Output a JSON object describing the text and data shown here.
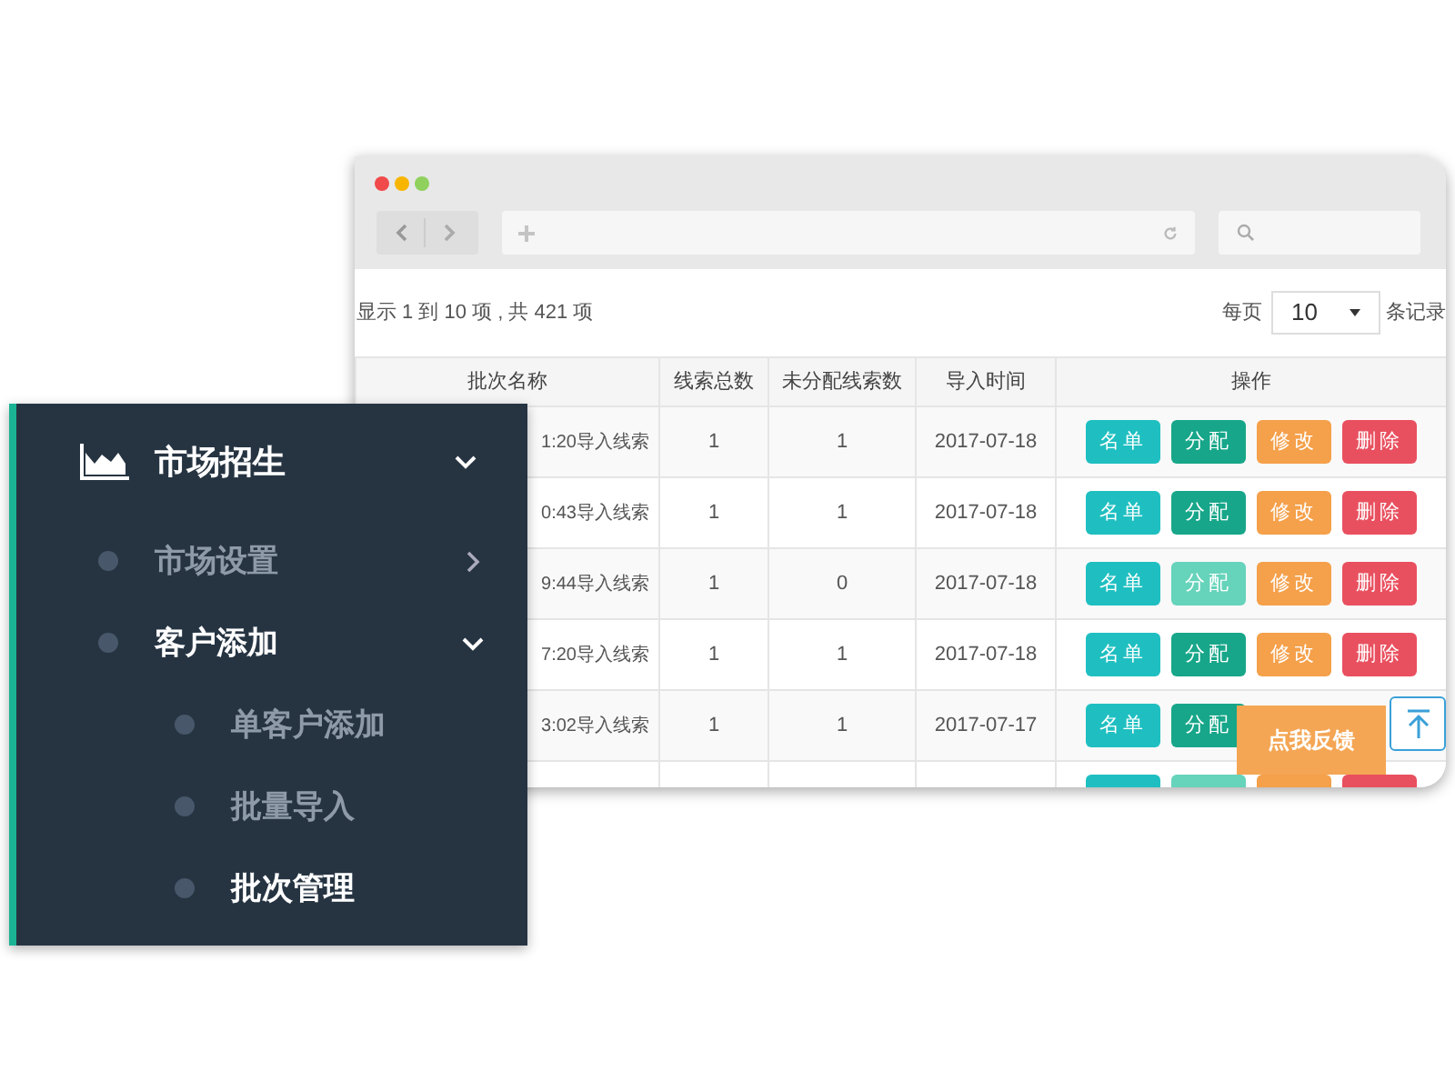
{
  "browser": {
    "pagination": {
      "summary": "显示 1 到 10 项 , 共 421 项",
      "per_page_label": "每页",
      "per_page": "10",
      "per_page_suffix": "条记录"
    },
    "table": {
      "columns": [
        "批次名称",
        "线索总数",
        "未分配线索数",
        "导入时间",
        "操作"
      ],
      "rows": [
        {
          "name": "1:20导入线索",
          "total": "1",
          "unassigned": "1",
          "date": "2017-07-18",
          "actions": [
            {
              "kind": "list",
              "label": "名单"
            },
            {
              "kind": "assign",
              "label": "分配",
              "disabled": false
            },
            {
              "kind": "edit",
              "label": "修改"
            },
            {
              "kind": "delete",
              "label": "删除"
            }
          ]
        },
        {
          "name": "0:43导入线索",
          "total": "1",
          "unassigned": "1",
          "date": "2017-07-18",
          "actions": [
            {
              "kind": "list",
              "label": "名单"
            },
            {
              "kind": "assign",
              "label": "分配",
              "disabled": false
            },
            {
              "kind": "edit",
              "label": "修改"
            },
            {
              "kind": "delete",
              "label": "删除"
            }
          ]
        },
        {
          "name": "9:44导入线索",
          "total": "1",
          "unassigned": "0",
          "date": "2017-07-18",
          "actions": [
            {
              "kind": "list",
              "label": "名单"
            },
            {
              "kind": "assign",
              "label": "分配",
              "disabled": true
            },
            {
              "kind": "edit",
              "label": "修改"
            },
            {
              "kind": "delete",
              "label": "删除"
            }
          ]
        },
        {
          "name": "7:20导入线索",
          "total": "1",
          "unassigned": "1",
          "date": "2017-07-18",
          "actions": [
            {
              "kind": "list",
              "label": "名单"
            },
            {
              "kind": "assign",
              "label": "分配",
              "disabled": false
            },
            {
              "kind": "edit",
              "label": "修改"
            },
            {
              "kind": "delete",
              "label": "删除"
            }
          ]
        },
        {
          "name": "3:02导入线索",
          "total": "1",
          "unassigned": "1",
          "date": "2017-07-17",
          "actions": [
            {
              "kind": "list",
              "label": "名单"
            },
            {
              "kind": "assign",
              "label": "分配",
              "disabled": false
            }
          ]
        },
        {
          "actions": [
            {
              "kind": "list"
            },
            {
              "kind": "assign",
              "disabled": true
            },
            {
              "kind": "edit"
            },
            {
              "kind": "delete"
            }
          ]
        }
      ]
    },
    "feedback_button": "点我反馈"
  },
  "sidebar": {
    "label": "市场招生",
    "expanded": true,
    "children": [
      {
        "label": "市场设置",
        "selected": false,
        "expanded": false
      },
      {
        "label": "客户添加",
        "selected": true,
        "expanded": true,
        "children": [
          {
            "label": "单客户添加",
            "selected": false
          },
          {
            "label": "批量导入",
            "selected": false
          },
          {
            "label": "批次管理",
            "selected": true
          }
        ]
      }
    ]
  }
}
